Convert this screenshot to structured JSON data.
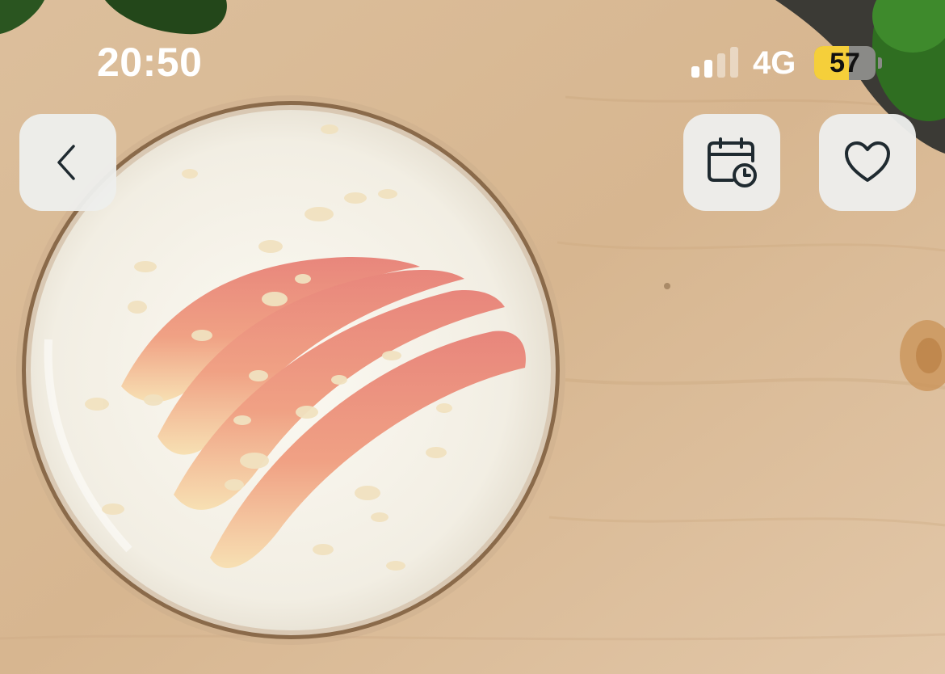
{
  "status_bar": {
    "time": "20:50",
    "network": "4G",
    "battery_level": "57",
    "battery_fraction": 0.57,
    "signal_bars_active": 2,
    "signal_bars_total": 4
  },
  "nav": {
    "back_icon": "chevron-left-icon",
    "schedule_icon": "calendar-clock-icon",
    "favorite_icon": "heart-outline-icon"
  },
  "photo": {
    "subject_icon": "yogurt-bowl-with-apple-slices-photo"
  },
  "colors": {
    "status_text": "#ffffff",
    "battery_fill": "#f5cf3a",
    "battery_track": "#8a8a87",
    "button_bg": "#edeeec",
    "icon_stroke": "#1f2a30",
    "wood": "#d8b792",
    "yogurt": "#f6f3ea",
    "apple_skin": "#e27f76",
    "apple_flesh": "#f6dfb0"
  }
}
